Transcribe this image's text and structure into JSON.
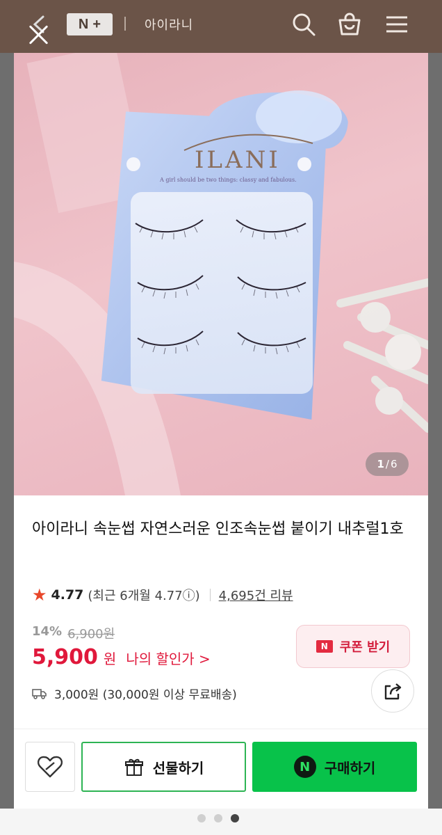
{
  "header": {
    "badge_n": "N",
    "badge_plus": "+",
    "brand_name": "아이라니",
    "icons": [
      "close-icon",
      "back-icon",
      "search-icon",
      "shopping-bag-icon",
      "menu-icon"
    ]
  },
  "gallery": {
    "current": "1",
    "separator": "/",
    "total": "6",
    "product_brand_text": "ILANI",
    "product_slogan": "A girl should be two things: classy and fabulous."
  },
  "product": {
    "title": "아이라니 속눈썹 자연스러운 인조속눈썹 붙이기 내추럴1호",
    "rating": "4.77",
    "rating_detail": "(최근 6개월 4.77ⓘ)",
    "reviews": "4,695건 리뷰",
    "discount": "14%",
    "original_price": "6,900원",
    "price": "5,900",
    "price_unit": "원",
    "my_price_link": "나의 할인가 >",
    "coupon_badge": "N",
    "coupon_label": "쿠폰 받기",
    "shipping": "3,000원 (30,000원 이상 무료배송)"
  },
  "actions": {
    "gift_label": "선물하기",
    "buy_badge": "N",
    "buy_label": "구매하기"
  },
  "colors": {
    "header_bg": "#6b5448",
    "price_red": "#e0183b",
    "buy_green": "#08c24a",
    "star": "#e8472a"
  }
}
